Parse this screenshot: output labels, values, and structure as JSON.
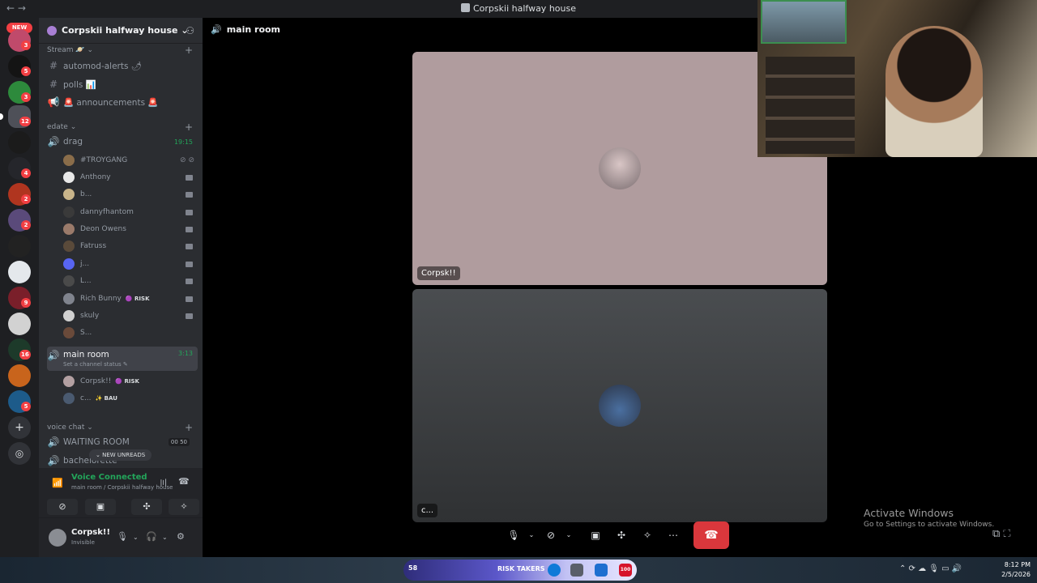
{
  "window": {
    "title": "Corpskii halfway house",
    "nav": "← →"
  },
  "rail": {
    "new_label": "NEW",
    "badges": [
      "3",
      "5",
      "3",
      "12",
      "4",
      "2",
      "2",
      "9",
      "16",
      "5"
    ]
  },
  "sidebar": {
    "server_name": "Corpskii halfway house ⌄",
    "categories": {
      "stream": "Stream 🪐 ⌄",
      "edate": "edate ⌄",
      "voice_chat": "voice chat ⌄"
    },
    "text_channels": [
      {
        "name": "automod-alerts 🌶",
        "icon": "#"
      },
      {
        "name": "polls 📊",
        "icon": "#"
      },
      {
        "name": "🚨 announcements 🚨",
        "icon": "📢"
      }
    ],
    "drag": {
      "name": "drag",
      "time": "19:15"
    },
    "drag_members": [
      {
        "name": "#TROYGANG",
        "tag": ""
      },
      {
        "name": "Anthony",
        "tag": ""
      },
      {
        "name": "b...",
        "tag": ""
      },
      {
        "name": "dannyfhantom",
        "tag": ""
      },
      {
        "name": "Deon Owens",
        "tag": ""
      },
      {
        "name": "Fatruss",
        "tag": ""
      },
      {
        "name": "j...",
        "tag": ""
      },
      {
        "name": "L...",
        "tag": ""
      },
      {
        "name": "Rich Bunny",
        "tag": "🟣 RISK"
      },
      {
        "name": "skuly",
        "tag": ""
      },
      {
        "name": "S...",
        "tag": ""
      }
    ],
    "main_room": {
      "name": "main room",
      "time": "3:13",
      "status": "Set a channel status ✎"
    },
    "main_room_members": [
      {
        "name": "Corpsk!!",
        "tag": "🟣 RISK"
      },
      {
        "name": "c...",
        "tag": "✨ BAU"
      }
    ],
    "waiting_room": {
      "name": "WAITING ROOM",
      "count_a": "00",
      "count_b": "50"
    },
    "bachelorette": "bachelorette",
    "new_unreads": "⌄ NEW UNREADS"
  },
  "voice_panel": {
    "status": "Voice Connected",
    "location": "main room / Corpskii halfway house"
  },
  "user_panel": {
    "name": "Corpsk!!",
    "status": "Invisible"
  },
  "main": {
    "channel_title": "main room",
    "tiles": [
      {
        "name": "Corpsk!!"
      },
      {
        "name": "c..."
      }
    ]
  },
  "overlay": {
    "activate_title": "Activate Windows",
    "activate_sub": "Go to Settings to activate Windows."
  },
  "taskbar": {
    "count": "58",
    "group_label": "RISK TAKERS",
    "app_badge": "100",
    "time": "8:12 PM",
    "date": "2/5/2026"
  },
  "colors": {
    "accent_green": "#23a55a",
    "hangup_red": "#da373c",
    "badge_red": "#f23f43"
  }
}
